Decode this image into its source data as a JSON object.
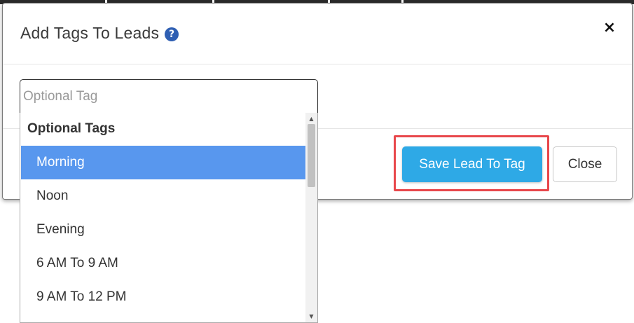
{
  "modal": {
    "title": "Add Tags To Leads",
    "help_icon": "?",
    "close_icon": "×"
  },
  "tag_input": {
    "placeholder": "Optional Tag",
    "value": ""
  },
  "dropdown": {
    "group_label": "Optional Tags",
    "items": [
      {
        "label": "Morning",
        "active": true
      },
      {
        "label": "Noon",
        "active": false
      },
      {
        "label": "Evening",
        "active": false
      },
      {
        "label": "6 AM To 9 AM",
        "active": false
      },
      {
        "label": "9 AM To 12 PM",
        "active": false
      }
    ],
    "scroll_up_glyph": "▲",
    "scroll_down_glyph": "▼"
  },
  "buttons": {
    "save_label": "Save Lead To Tag",
    "close_label": "Close"
  },
  "colors": {
    "save_button": "#2ea9e6",
    "active_item": "#5897ee",
    "highlight_border": "#e8474b",
    "help_icon": "#2f5fb3"
  }
}
